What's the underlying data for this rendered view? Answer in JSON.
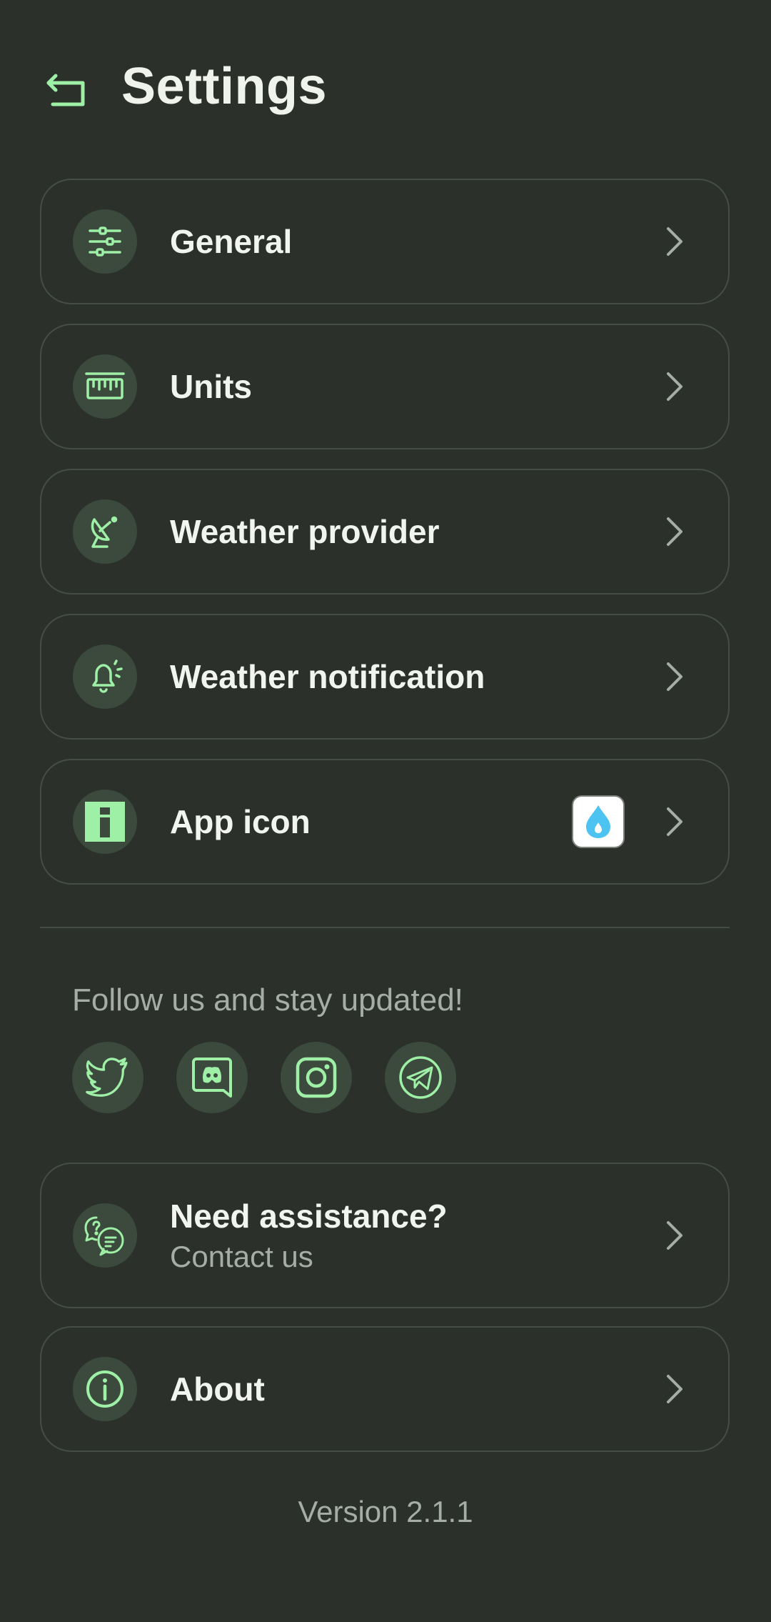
{
  "header": {
    "title": "Settings"
  },
  "menu": [
    {
      "label": "General",
      "icon": "sliders-icon"
    },
    {
      "label": "Units",
      "icon": "ruler-icon"
    },
    {
      "label": "Weather provider",
      "icon": "satellite-dish-icon"
    },
    {
      "label": "Weather notification",
      "icon": "bell-icon"
    },
    {
      "label": "App icon",
      "icon": "info-square-icon"
    }
  ],
  "follow": {
    "text": "Follow us and stay updated!",
    "socials": [
      "twitter-icon",
      "discord-icon",
      "instagram-icon",
      "telegram-icon"
    ]
  },
  "assistance": {
    "title": "Need assistance?",
    "subtitle": "Contact us"
  },
  "about": {
    "label": "About"
  },
  "footer": {
    "version": "Version 2.1.1"
  },
  "colors": {
    "accent": "#9ef0a6",
    "background": "#2b302b",
    "icon_bg": "#3b4a3c",
    "muted": "#a6aca6"
  }
}
